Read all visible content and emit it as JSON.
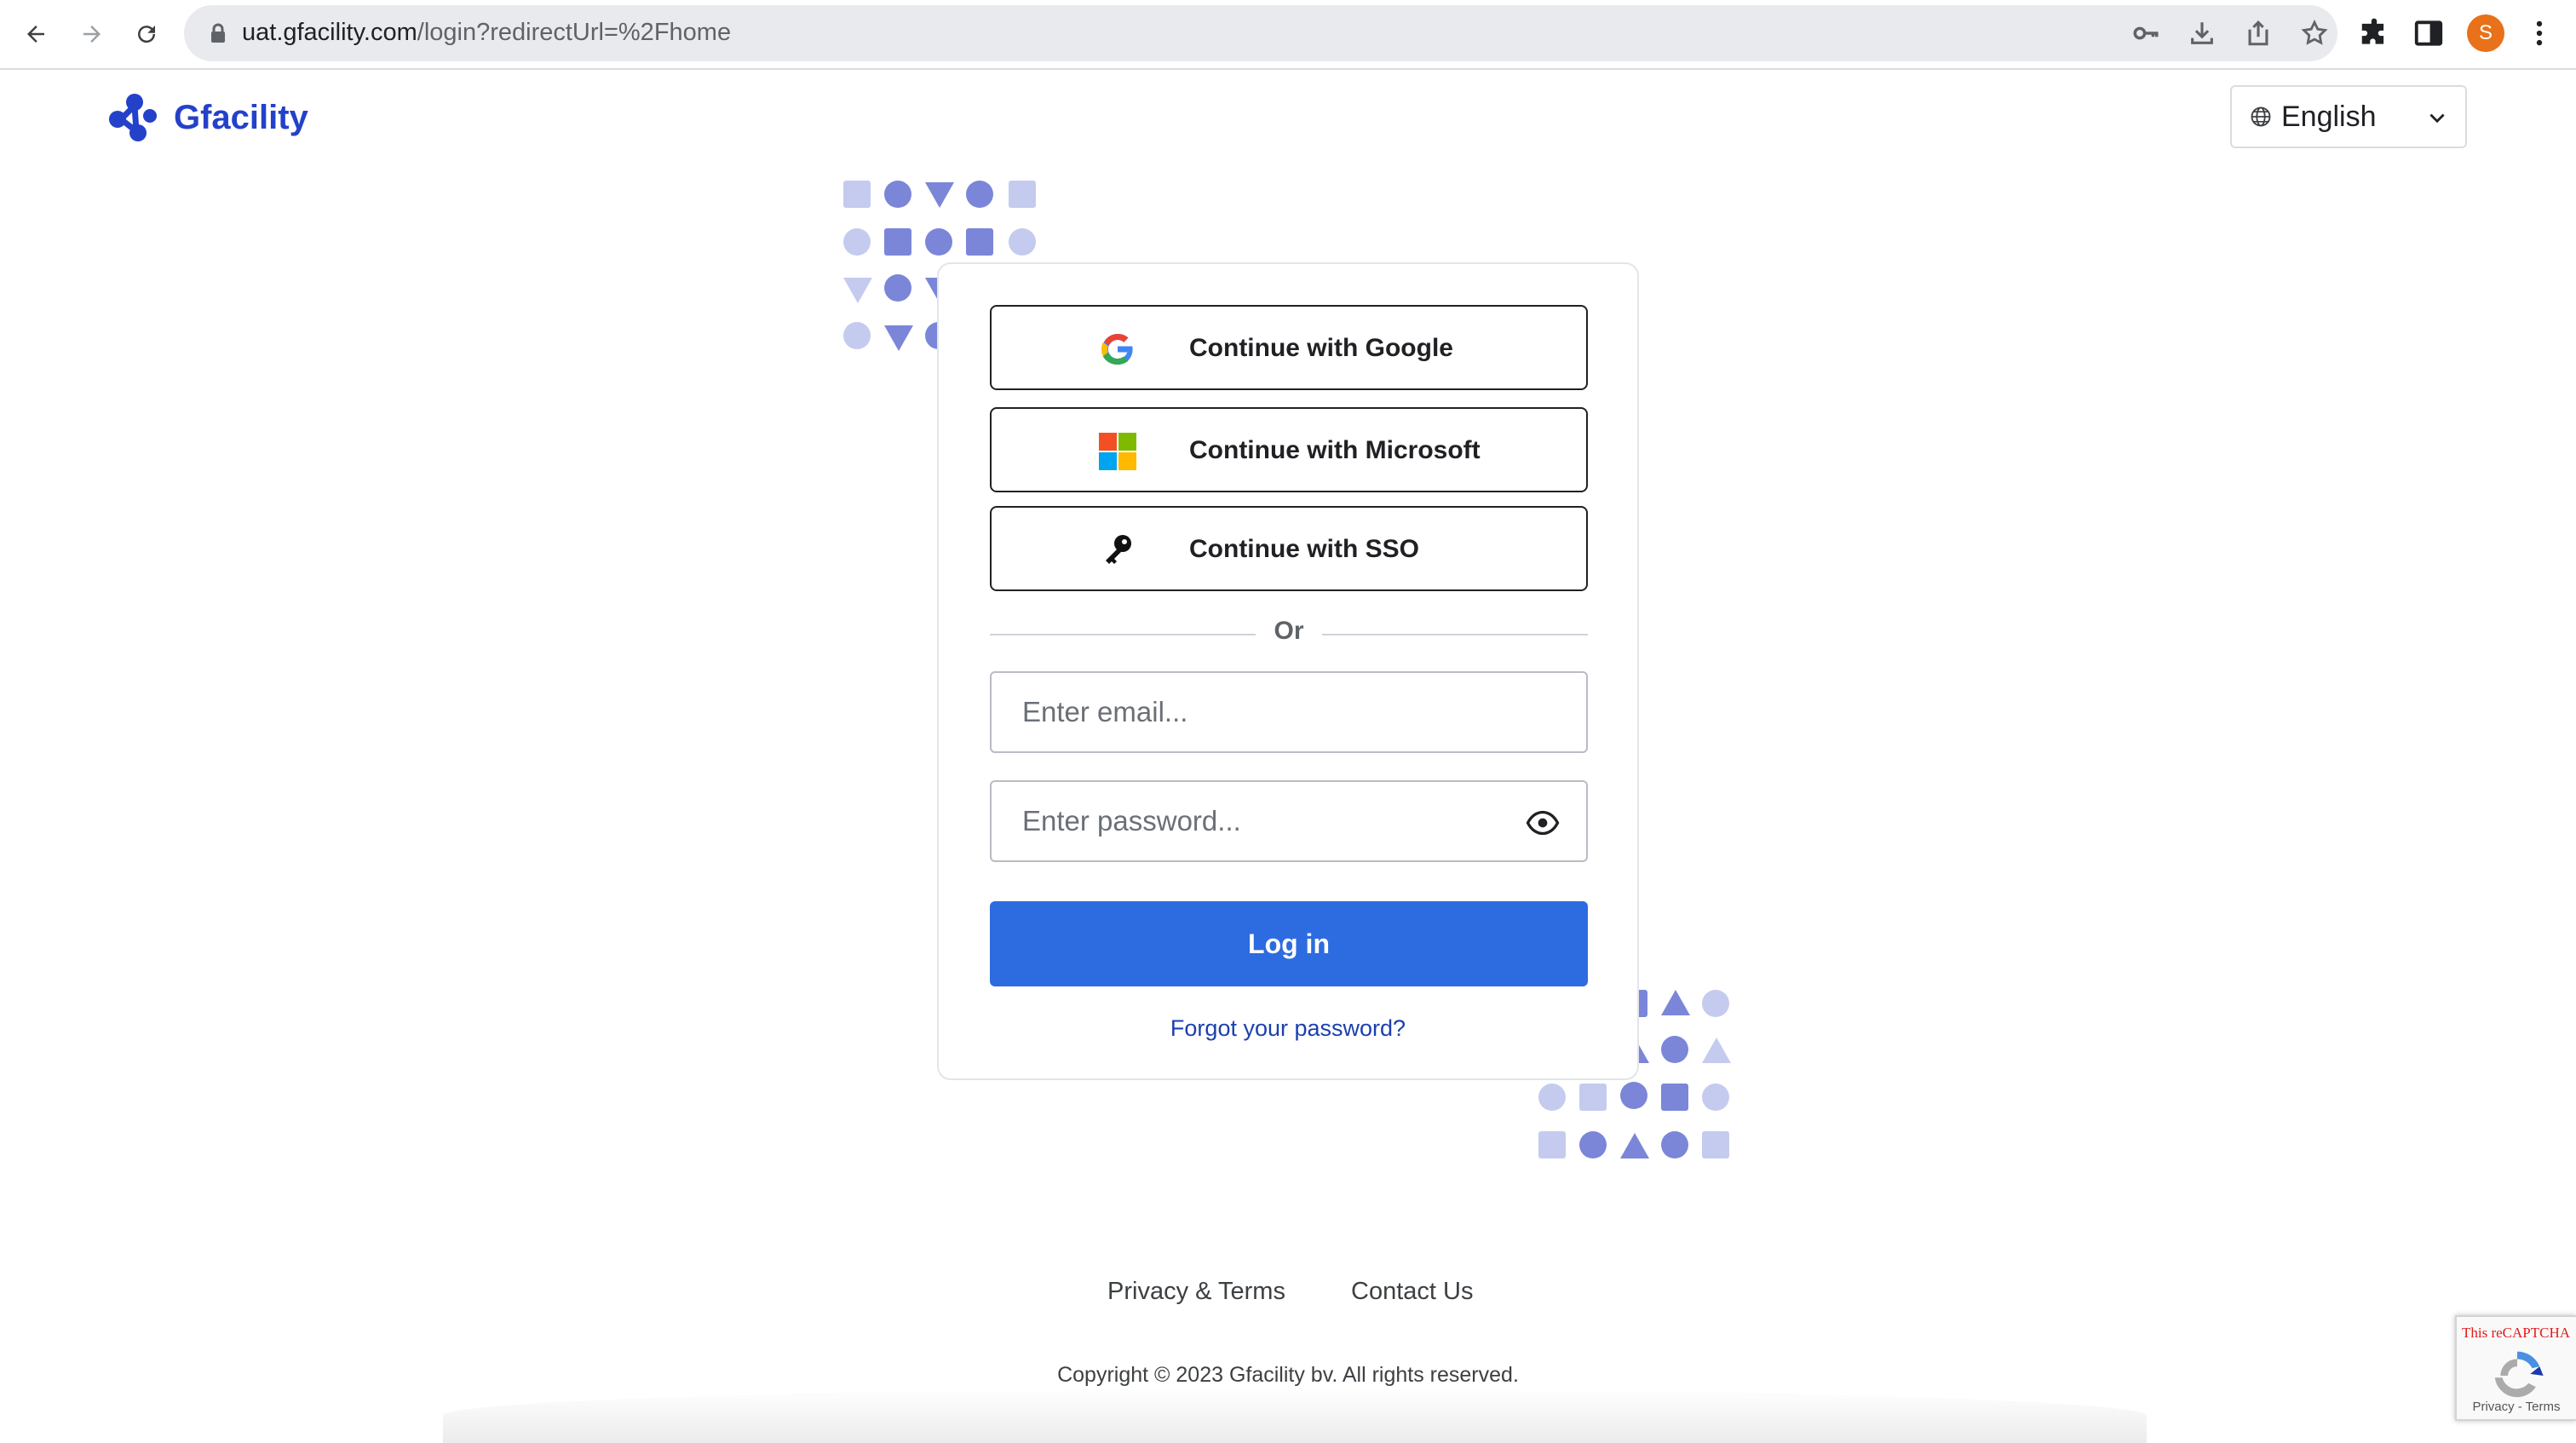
{
  "browser": {
    "url_host": "uat.gfacility.com",
    "url_path": "/login?redirectUrl=%2Fhome",
    "profile_initial": "S"
  },
  "header": {
    "brand": "Gfacility",
    "language": "English"
  },
  "login": {
    "google_label": "Continue with Google",
    "microsoft_label": "Continue with Microsoft",
    "sso_label": "Continue with SSO",
    "or_label": "Or",
    "email_placeholder": "Enter email...",
    "password_placeholder": "Enter password...",
    "login_label": "Log in",
    "forgot_label": "Forgot your password?"
  },
  "footer": {
    "privacy_label": "Privacy & Terms",
    "contact_label": "Contact Us",
    "copyright": "Copyright © 2023 Gfacility bv. All rights reserved."
  },
  "recaptcha": {
    "error_text": "This reCAPTCHA site admin If you a",
    "terms": "Privacy - Terms"
  },
  "colors": {
    "brand": "#2441c9",
    "primary_button": "#2d6be0",
    "shape_light": "#c5cbee",
    "shape_dark": "#7b86d8"
  },
  "icons": [
    "back-icon",
    "forward-icon",
    "reload-icon",
    "lock-icon",
    "key-icon",
    "download-icon",
    "share-icon",
    "star-icon",
    "extensions-icon",
    "sidepanel-icon",
    "menu-icon",
    "globe-icon",
    "chevron-down-icon",
    "google-icon",
    "microsoft-icon",
    "sso-key-icon",
    "eye-icon",
    "recaptcha-icon"
  ]
}
